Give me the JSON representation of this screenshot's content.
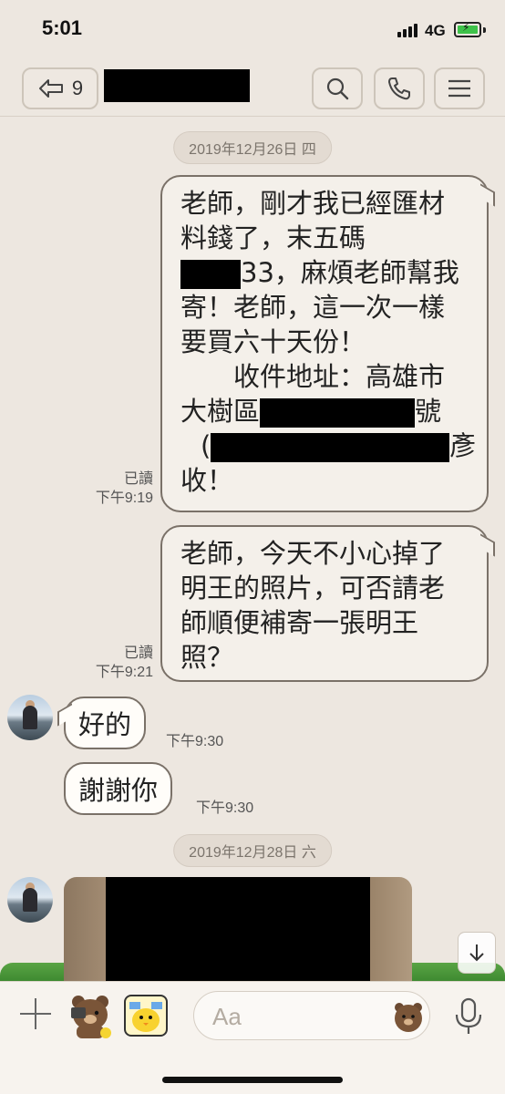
{
  "status_bar": {
    "time": "5:01",
    "network": "4G"
  },
  "header": {
    "unread_count": "9"
  },
  "dates": [
    "2019年12月26日 四",
    "2019年12月28日 六"
  ],
  "messages": {
    "m1": {
      "lines": [
        "老師，剛才我已經匯材",
        "料錢了，末五碼",
        "33，麻煩老師幫我",
        "寄！老師，這一次一樣",
        "要買六十天份！",
        "收件地址：高雄市",
        "大樹區",
        "號",
        "(",
        "彥",
        "收！"
      ],
      "read": "已讀",
      "time": "下午9:19"
    },
    "m2": {
      "lines": [
        "老師，今天不小心掉了",
        "明王的照片，可否請老",
        "師順便補寄一張明王",
        "照？"
      ],
      "read": "已讀",
      "time": "下午9:21"
    },
    "m3": {
      "text": "好的",
      "time": "下午9:30"
    },
    "m4": {
      "text": "謝謝你",
      "time": "下午9:30"
    }
  },
  "input": {
    "placeholder": "Aa"
  },
  "icons": [
    "back-arrow-icon",
    "search-icon",
    "phone-icon",
    "menu-icon",
    "plus-icon",
    "sticker-bear-icon",
    "sticker-chick-icon",
    "emoji-bear-icon",
    "mic-icon",
    "chevron-down-icon"
  ],
  "colors": {
    "background": "#ede7e0",
    "bubble_border": "#7a7168",
    "grass": "#4f9a3c"
  }
}
